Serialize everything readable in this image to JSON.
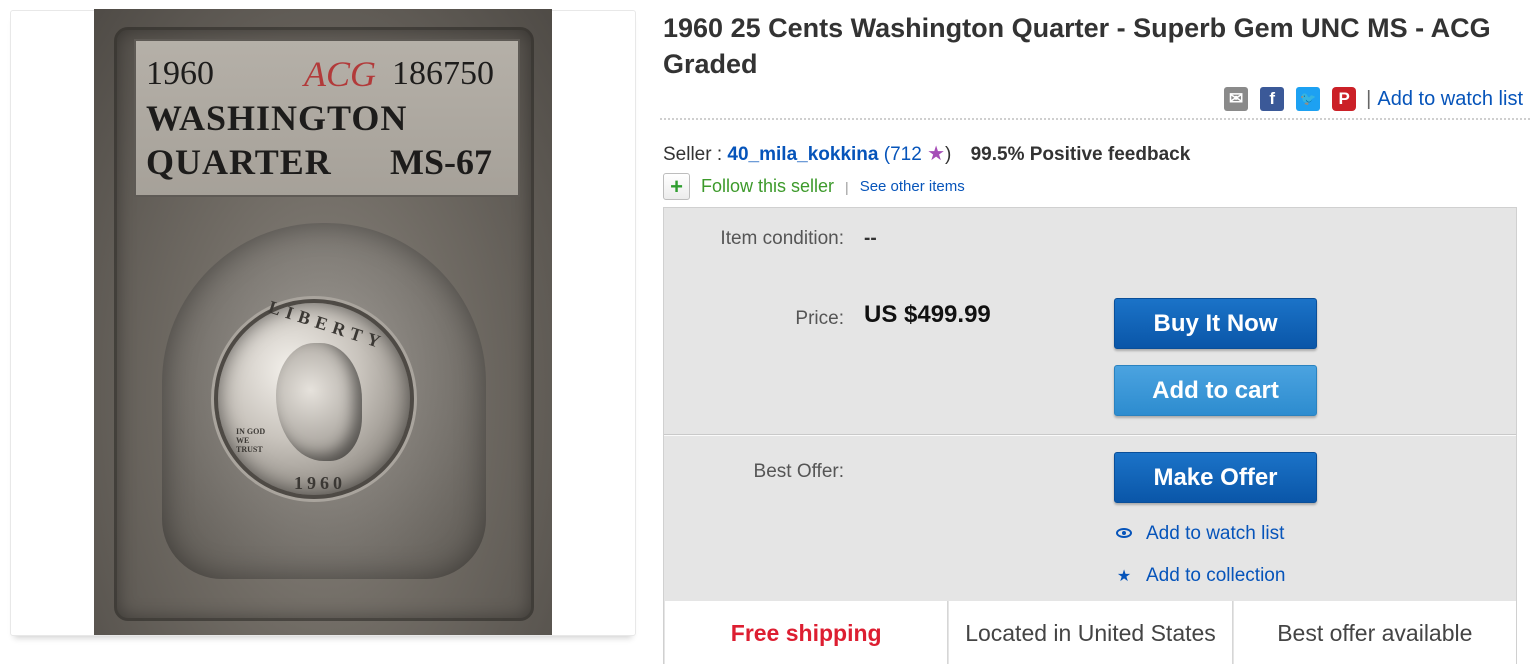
{
  "product_image": {
    "label_year": "1960",
    "label_grader": "ACG",
    "label_cert": "186750",
    "label_line2": "WASHINGTON",
    "label_line3": "QUARTER",
    "label_grade": "MS-67",
    "coin_top": "LIBERTY",
    "coin_motto": "IN GOD WE TRUST",
    "coin_year": "1960"
  },
  "listing": {
    "title": "1960 25 Cents Washington Quarter - Superb Gem UNC MS - ACG Graded"
  },
  "share": {
    "icons": [
      "mail-icon",
      "facebook-icon",
      "twitter-icon",
      "pinterest-icon"
    ],
    "separator": "|",
    "watch_label": "Add to watch list"
  },
  "seller": {
    "prefix": "Seller :",
    "name": "40_mila_kokkina",
    "open_paren": "(",
    "score": "712",
    "star": "★",
    "close_paren": ")",
    "feedback": "99.5% Positive feedback",
    "follow_label": "Follow this seller",
    "separator": "|",
    "other_items": "See other items"
  },
  "details": {
    "condition_label": "Item condition:",
    "condition_value": "--",
    "price_label": "Price:",
    "price_value": "US $499.99",
    "buy_now": "Buy It Now",
    "add_to_cart": "Add to cart",
    "offer_label": "Best Offer:",
    "make_offer": "Make Offer",
    "watch_link": "Add to watch list",
    "collection_link": "Add to collection"
  },
  "features": {
    "shipping": "Free shipping",
    "location": "Located in United States",
    "offer": "Best offer available"
  },
  "colors": {
    "link": "#0654ba",
    "button_dark": "#0a56a8",
    "button_light": "#2d8ccf",
    "free_shipping": "#dd1e31",
    "follow_green": "#3d9a2b"
  }
}
